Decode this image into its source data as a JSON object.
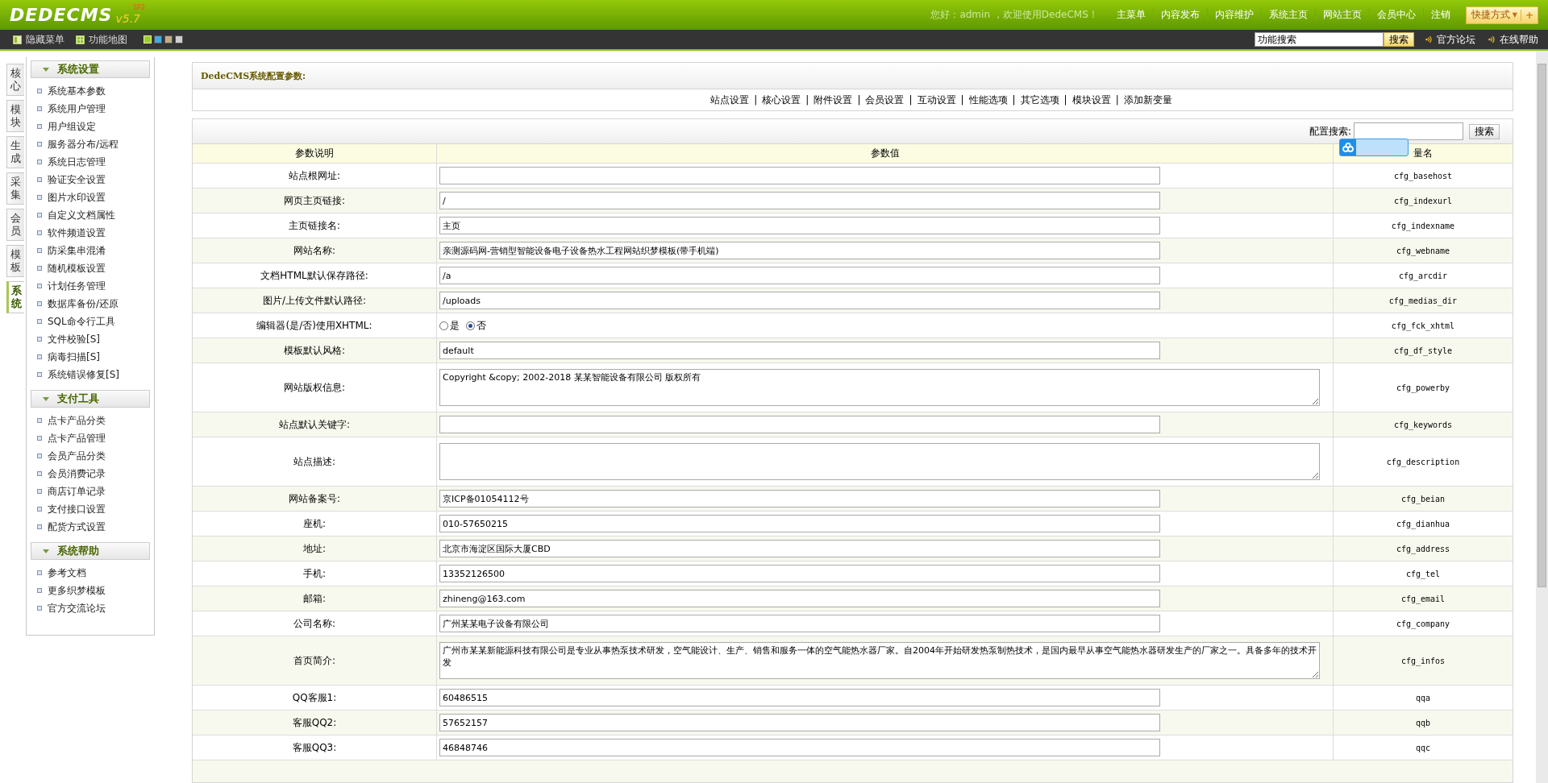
{
  "header": {
    "logo": "DEDECMS",
    "version": "v5.7",
    "edition": "SP2",
    "greeting": "您好：admin ，欢迎使用DedeCMS！",
    "nav": [
      "主菜单",
      "内容发布",
      "内容维护",
      "系统主页",
      "网站主页",
      "会员中心",
      "注销"
    ],
    "shortcut": {
      "label": "快捷方式",
      "caret": "▼",
      "add": "+"
    }
  },
  "toolbar": {
    "hide_menu": "隐藏菜单",
    "site_map": "功能地图",
    "themes": [
      {
        "color": "#9acd32",
        "selected": true
      },
      {
        "color": "#45a9e3",
        "selected": false
      },
      {
        "color": "#c4ad86",
        "selected": false
      },
      {
        "color": "#cfcfcf",
        "selected": false
      }
    ],
    "search": {
      "value": "功能搜索",
      "button": "搜索"
    },
    "links": [
      "官方论坛",
      "在线帮助"
    ]
  },
  "sidebar": {
    "tabs": [
      {
        "label": "核心",
        "selected": false
      },
      {
        "label": "模块",
        "selected": false
      },
      {
        "label": "生成",
        "selected": false
      },
      {
        "label": "采集",
        "selected": false
      },
      {
        "label": "会员",
        "selected": false
      },
      {
        "label": "模板",
        "selected": false
      },
      {
        "label": "系统",
        "selected": true
      }
    ],
    "groups": [
      {
        "title": "系统设置",
        "items": [
          "系统基本参数",
          "系统用户管理",
          "用户组设定",
          "服务器分布/远程",
          "系统日志管理",
          "验证安全设置",
          "图片水印设置",
          "自定义文档属性",
          "软件频道设置",
          "防采集串混淆",
          "随机模板设置",
          "计划任务管理",
          "数据库备份/还原",
          "SQL命令行工具",
          "文件校验[S]",
          "病毒扫描[S]",
          "系统错误修复[S]"
        ]
      },
      {
        "title": "支付工具",
        "items": [
          "点卡产品分类",
          "点卡产品管理",
          "会员产品分类",
          "会员消费记录",
          "商店订单记录",
          "支付接口设置",
          "配货方式设置"
        ]
      },
      {
        "title": "系统帮助",
        "items": [
          "参考文档",
          "更多织梦模板",
          "官方交流论坛"
        ]
      }
    ]
  },
  "main": {
    "title": "DedeCMS系统配置参数:",
    "tabs": [
      "站点设置",
      "核心设置",
      "附件设置",
      "会员设置",
      "互动设置",
      "性能选项",
      "其它选项",
      "模块设置",
      "添加新变量"
    ],
    "separator": "|",
    "search": {
      "label": "配置搜索:",
      "button": "搜索"
    },
    "columns": [
      "参数说明",
      "参数值",
      "量名"
    ],
    "rows": [
      {
        "label": "站点根网址:",
        "kind": "text",
        "name": "cfg_basehost"
      },
      {
        "label": "网页主页链接:",
        "kind": "text",
        "value": "/",
        "name": "cfg_indexurl"
      },
      {
        "label": "主页链接名:",
        "kind": "text",
        "value": "主页",
        "name": "cfg_indexname"
      },
      {
        "label": "网站名称:",
        "kind": "text",
        "value": "亲测源码网-营销型智能设备电子设备热水工程网站织梦模板(带手机端)",
        "name": "cfg_webname"
      },
      {
        "label": "文档HTML默认保存路径:",
        "kind": "text",
        "value": "/a",
        "name": "cfg_arcdir"
      },
      {
        "label": "图片/上传文件默认路径:",
        "kind": "text",
        "value": "/uploads",
        "name": "cfg_medias_dir"
      },
      {
        "label": "编辑器(是/否)使用XHTML:",
        "kind": "radio",
        "options": [
          {
            "label": "是",
            "selected": false
          },
          {
            "label": "否",
            "selected": true
          }
        ],
        "name": "cfg_fck_xhtml"
      },
      {
        "label": "模板默认风格:",
        "kind": "text",
        "value": "default",
        "name": "cfg_df_style"
      },
      {
        "label": "网站版权信息:",
        "kind": "textarea",
        "value": "Copyright &copy; 2002-2018 某某智能设备有限公司 版权所有",
        "name": "cfg_powerby"
      },
      {
        "label": "站点默认关键字:",
        "kind": "text",
        "name": "cfg_keywords"
      },
      {
        "label": "站点描述:",
        "kind": "textarea",
        "name": "cfg_description"
      },
      {
        "label": "网站备案号:",
        "kind": "text",
        "value": "京ICP备01054112号",
        "name": "cfg_beian"
      },
      {
        "label": "座机:",
        "kind": "text",
        "value": "010-57650215",
        "name": "cfg_dianhua"
      },
      {
        "label": "地址:",
        "kind": "text",
        "value": "北京市海淀区国际大厦CBD",
        "name": "cfg_address"
      },
      {
        "label": "手机:",
        "kind": "text",
        "value": "13352126500",
        "name": "cfg_tel"
      },
      {
        "label": "邮箱:",
        "kind": "text",
        "value": "zhineng@163.com",
        "name": "cfg_email"
      },
      {
        "label": "公司名称:",
        "kind": "text",
        "value": "广州某某电子设备有限公司",
        "name": "cfg_company"
      },
      {
        "label": "首页简介:",
        "kind": "textarea",
        "value": "广州市某某新能源科技有限公司是专业从事热泵技术研发，空气能设计、生产、销售和服务一体的空气能热水器厂家。自2004年开始研发热泵制热技术，是国内最早从事空气能热水器研发生产的厂家之一。具备多年的技术开发",
        "name": "cfg_infos"
      },
      {
        "label": "QQ客服1:",
        "kind": "text",
        "value": "60486515",
        "name": "qqa"
      },
      {
        "label": "客服QQ2:",
        "kind": "text",
        "value": "57652157",
        "name": "qqb"
      },
      {
        "label": "客服QQ3:",
        "kind": "text",
        "value": "46848746",
        "name": "qqc"
      }
    ]
  }
}
